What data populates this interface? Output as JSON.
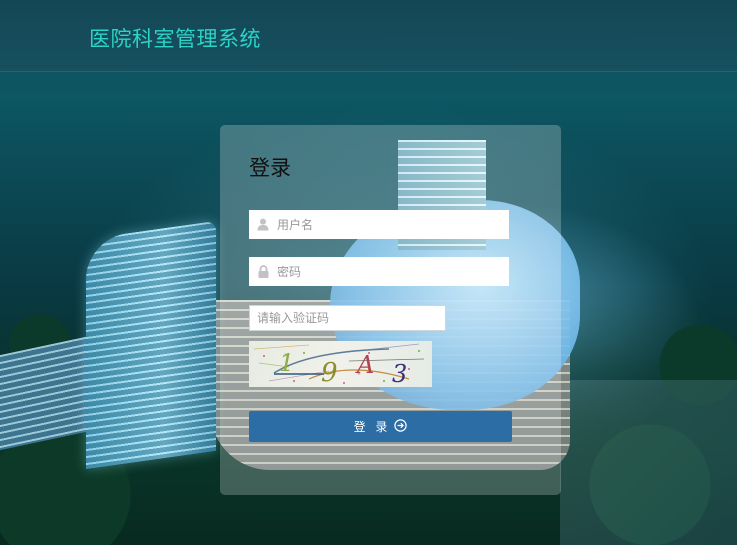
{
  "header": {
    "app_title": "医院科室管理系统"
  },
  "login": {
    "title": "登录",
    "username_placeholder": "用户名",
    "password_placeholder": "密码",
    "captcha_placeholder": "请输入验证码",
    "captcha_text": "19A3",
    "submit_label": "登 录",
    "icons": {
      "username": "user-icon",
      "password": "lock-icon",
      "submit": "arrow-right-circle-icon"
    }
  },
  "colors": {
    "header_title": "#2cd3c6",
    "button_bg": "#2c6da5",
    "card_bg": "rgba(255,255,255,0.23)"
  }
}
